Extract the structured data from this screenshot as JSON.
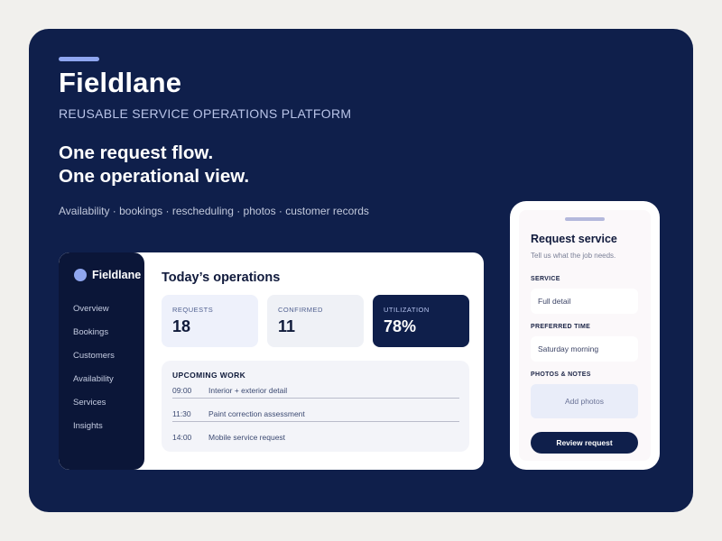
{
  "brand": {
    "name": "Fieldlane",
    "subtitle": "REUSABLE SERVICE OPERATIONS PLATFORM",
    "headline_line1": "One request flow.",
    "headline_line2": "One operational view.",
    "features": "Availability · bookings · rescheduling · photos · customer records"
  },
  "colors": {
    "hero_bg": "#0f1f4b",
    "sidebar_bg": "#0b1638",
    "accent": "#8fa6f0",
    "page_bg": "#f1f0ed"
  },
  "dashboard": {
    "sidebar": {
      "logo_icon": "circle-logo-icon",
      "brand": "Fieldlane",
      "items": [
        {
          "label": "Overview"
        },
        {
          "label": "Bookings"
        },
        {
          "label": "Customers"
        },
        {
          "label": "Availability"
        },
        {
          "label": "Services"
        },
        {
          "label": "Insights"
        }
      ]
    },
    "title": "Today’s operations",
    "stats": [
      {
        "label": "REQUESTS",
        "value": "18"
      },
      {
        "label": "CONFIRMED",
        "value": "11"
      },
      {
        "label": "UTILIZATION",
        "value": "78%"
      }
    ],
    "upcoming": {
      "title": "UPCOMING WORK",
      "rows": [
        {
          "time": "09:00",
          "task": "Interior + exterior detail"
        },
        {
          "time": "11:30",
          "task": "Paint correction assessment"
        },
        {
          "time": "14:00",
          "task": "Mobile service request"
        }
      ]
    }
  },
  "phone": {
    "title": "Request service",
    "subtitle": "Tell us what the job needs.",
    "service_label": "SERVICE",
    "service_value": "Full detail",
    "time_label": "PREFERRED TIME",
    "time_value": "Saturday morning",
    "photos_label": "PHOTOS & NOTES",
    "photos_placeholder": "Add photos",
    "cta": "Review request"
  }
}
